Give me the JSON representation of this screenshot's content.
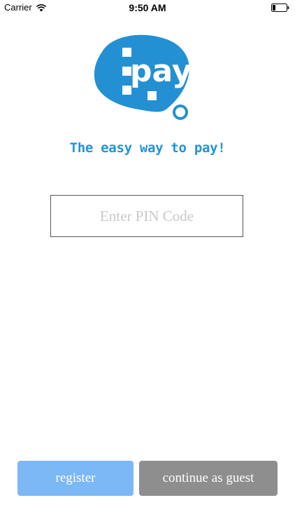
{
  "status_bar": {
    "carrier": "Carrier",
    "time": "9:50 AM"
  },
  "logo": {
    "text": "pay",
    "tagline": "The easy way to pay!",
    "brand_color": "#1f95d6"
  },
  "pin": {
    "placeholder": "Enter PIN Code",
    "value": ""
  },
  "buttons": {
    "register_label": "register",
    "guest_label": "continue as guest",
    "register_color": "#7cb8f6",
    "guest_color": "#8e8e8e"
  }
}
